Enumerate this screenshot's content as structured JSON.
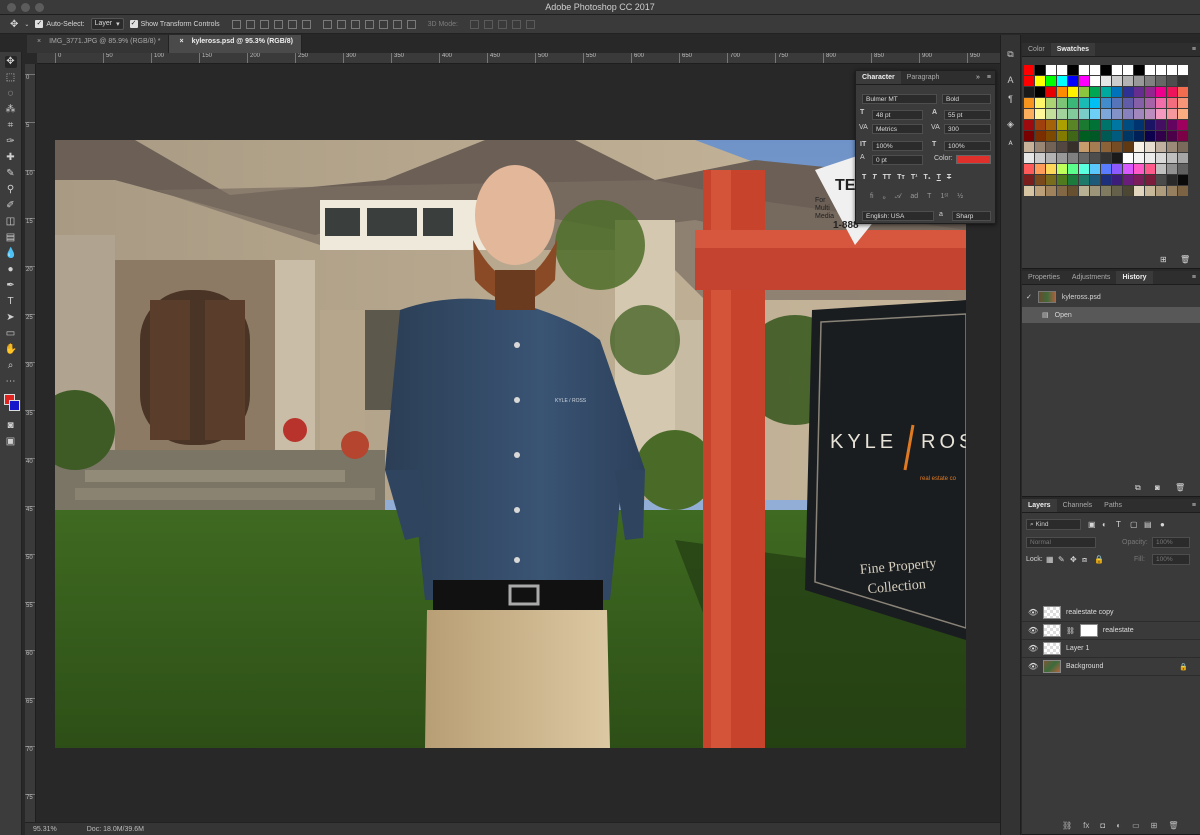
{
  "window": {
    "title": "Adobe Photoshop CC 2017"
  },
  "options": {
    "auto_select_label": "Auto-Select:",
    "auto_select_value": "Layer",
    "transform_label": "Show Transform Controls",
    "mode_3d": "3D Mode:"
  },
  "tabs": [
    {
      "label": "IMG_3771.JPG @ 85.9% (RGB/8) *"
    },
    {
      "label": "kyleross.psd @ 95.3% (RGB/8)"
    }
  ],
  "ruler": {
    "h": [
      "0",
      "50",
      "100",
      "150",
      "200",
      "250",
      "300",
      "350",
      "400",
      "450",
      "500",
      "550",
      "600",
      "650",
      "700",
      "750",
      "800",
      "850",
      "900",
      "950"
    ],
    "v": [
      "0",
      "5",
      "10",
      "15",
      "20",
      "25",
      "30",
      "35",
      "40",
      "45",
      "50",
      "55",
      "60",
      "65",
      "70",
      "75"
    ]
  },
  "colors": {
    "foreground": "#e0231f",
    "background": "#1515c9"
  },
  "status": {
    "zoom": "95.31%",
    "doc": "Doc: 18.0M/39.6M"
  },
  "character": {
    "tab_character": "Character",
    "tab_paragraph": "Paragraph",
    "font_family": "Bulmer MT",
    "font_style": "Bold",
    "size": "48 pt",
    "leading": "55 pt",
    "kerning": "Metrics",
    "tracking": "300",
    "vscale": "100%",
    "hscale": "100%",
    "baseline": "0 pt",
    "color_label": "Color:",
    "text_color": "#e0302c",
    "language": "English: USA",
    "antialias_prefix": "a",
    "antialias": "Sharp"
  },
  "swatches_panel": {
    "tab_color": "Color",
    "tab_swatches": "Swatches"
  },
  "history_panel": {
    "tab_properties": "Properties",
    "tab_adjustments": "Adjustments",
    "tab_history": "History",
    "doc": "kyleross.psd",
    "step": "Open"
  },
  "layers_panel": {
    "tab_layers": "Layers",
    "tab_channels": "Channels",
    "tab_paths": "Paths",
    "filter": "Kind",
    "blend": "Normal",
    "opacity_label": "Opacity:",
    "opacity": "100%",
    "lock_label": "Lock:",
    "fill_label": "Fill:",
    "fill": "100%",
    "layers": [
      {
        "name": "realestate copy"
      },
      {
        "name": "realestate"
      },
      {
        "name": "Layer 1"
      },
      {
        "name": "Background"
      }
    ]
  },
  "photo": {
    "shirt_logo": "KYLE / ROSS",
    "sign_brand_left": "KYLE",
    "sign_brand_right": "ROS",
    "sign_sub": "real estate co",
    "sign_line1": "Fine Property",
    "sign_line2": "Collection",
    "sign_small1": "TEX",
    "sign_small2": "For",
    "sign_small3": "Multi",
    "sign_small4": "Media",
    "sign_small5": "1-888"
  }
}
